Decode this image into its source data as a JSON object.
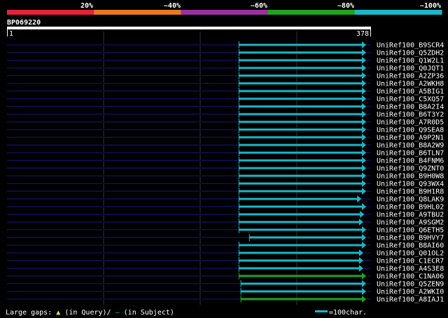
{
  "title": "BP069220",
  "ruler": {
    "start": "1",
    "end": "378"
  },
  "identity_scale": {
    "labels": [
      "20%",
      "~40%",
      "~60%",
      "~80%",
      "~100%"
    ],
    "colors": [
      "#e8213a",
      "#e87a1e",
      "#9a2fa0",
      "#1fa320",
      "#19b8c8"
    ]
  },
  "colors": {
    "row_line": "#0b0b45",
    "grid": "#333333",
    "bar": "#19b8c8",
    "bar_green": "#1fa320"
  },
  "query_length": 378,
  "hits": [
    {
      "name": "UniRef100_B9SCR4",
      "start": 245,
      "end": 378,
      "color": "#19b8c8"
    },
    {
      "name": "UniRef100_Q5ZDH2",
      "start": 245,
      "end": 378,
      "color": "#19b8c8"
    },
    {
      "name": "UniRef100_Q1W2L1",
      "start": 245,
      "end": 378,
      "color": "#19b8c8"
    },
    {
      "name": "UniRef100_Q0JQT1",
      "start": 245,
      "end": 378,
      "color": "#19b8c8"
    },
    {
      "name": "UniRef100_A2ZP36",
      "start": 245,
      "end": 378,
      "color": "#19b8c8"
    },
    {
      "name": "UniRef100_A2WKH8",
      "start": 245,
      "end": 378,
      "color": "#19b8c8"
    },
    {
      "name": "UniRef100_A5BIG1",
      "start": 245,
      "end": 378,
      "color": "#19b8c8"
    },
    {
      "name": "UniRef100_C5XQ57",
      "start": 245,
      "end": 378,
      "color": "#19b8c8"
    },
    {
      "name": "UniRef100_B8A2I4",
      "start": 245,
      "end": 378,
      "color": "#19b8c8"
    },
    {
      "name": "UniRef100_B6T3Y2",
      "start": 245,
      "end": 378,
      "color": "#19b8c8"
    },
    {
      "name": "UniRef100_A7R0D5",
      "start": 245,
      "end": 378,
      "color": "#19b8c8"
    },
    {
      "name": "UniRef100_Q9SEA8",
      "start": 245,
      "end": 378,
      "color": "#19b8c8"
    },
    {
      "name": "UniRef100_A9P2N1",
      "start": 245,
      "end": 378,
      "color": "#19b8c8"
    },
    {
      "name": "UniRef100_B8A2W9",
      "start": 245,
      "end": 378,
      "color": "#19b8c8"
    },
    {
      "name": "UniRef100_B6TLN7",
      "start": 245,
      "end": 378,
      "color": "#19b8c8"
    },
    {
      "name": "UniRef100_B4FNM6",
      "start": 245,
      "end": 378,
      "color": "#19b8c8"
    },
    {
      "name": "UniRef100_Q9ZNT0",
      "start": 245,
      "end": 378,
      "color": "#19b8c8"
    },
    {
      "name": "UniRef100_B9H0W8",
      "start": 245,
      "end": 378,
      "color": "#19b8c8"
    },
    {
      "name": "UniRef100_Q93WX4",
      "start": 245,
      "end": 378,
      "color": "#19b8c8"
    },
    {
      "name": "UniRef100_B9H1R8",
      "start": 245,
      "end": 378,
      "color": "#19b8c8"
    },
    {
      "name": "UniRef100_Q8LAK9",
      "start": 245,
      "end": 373,
      "color": "#19b8c8"
    },
    {
      "name": "UniRef100_B9HL02",
      "start": 245,
      "end": 378,
      "color": "#19b8c8"
    },
    {
      "name": "UniRef100_A9TBU2",
      "start": 245,
      "end": 376,
      "color": "#19b8c8"
    },
    {
      "name": "UniRef100_A9SGM2",
      "start": 245,
      "end": 375,
      "color": "#19b8c8"
    },
    {
      "name": "UniRef100_Q6ETH5",
      "start": 245,
      "end": 378,
      "color": "#19b8c8"
    },
    {
      "name": "UniRef100_B9HVY7",
      "start": 256,
      "end": 378,
      "color": "#19b8c8"
    },
    {
      "name": "UniRef100_B8AI60",
      "start": 245,
      "end": 378,
      "color": "#19b8c8"
    },
    {
      "name": "UniRef100_Q01OL2",
      "start": 245,
      "end": 375,
      "color": "#19b8c8"
    },
    {
      "name": "UniRef100_C1ECR7",
      "start": 245,
      "end": 375,
      "color": "#19b8c8"
    },
    {
      "name": "UniRef100_A4S3E8",
      "start": 245,
      "end": 375,
      "color": "#19b8c8"
    },
    {
      "name": "UniRef100_C1NA06",
      "start": 245,
      "end": 378,
      "color": "#1fa320"
    },
    {
      "name": "UniRef100_Q5ZEN9",
      "start": 247,
      "end": 378,
      "color": "#19b8c8"
    },
    {
      "name": "UniRef100_A2WKI0",
      "start": 247,
      "end": 378,
      "color": "#19b8c8"
    },
    {
      "name": "UniRef100_A8IAJ1",
      "start": 247,
      "end": 378,
      "color": "#1fa320"
    }
  ],
  "footer": {
    "legend_prefix": "Large gaps:",
    "triangle_glyph": "▲",
    "legend_query": "(in Query)/",
    "dash_glyph": "–",
    "legend_subject": " (in Subject)",
    "scale_label": "=100char."
  }
}
